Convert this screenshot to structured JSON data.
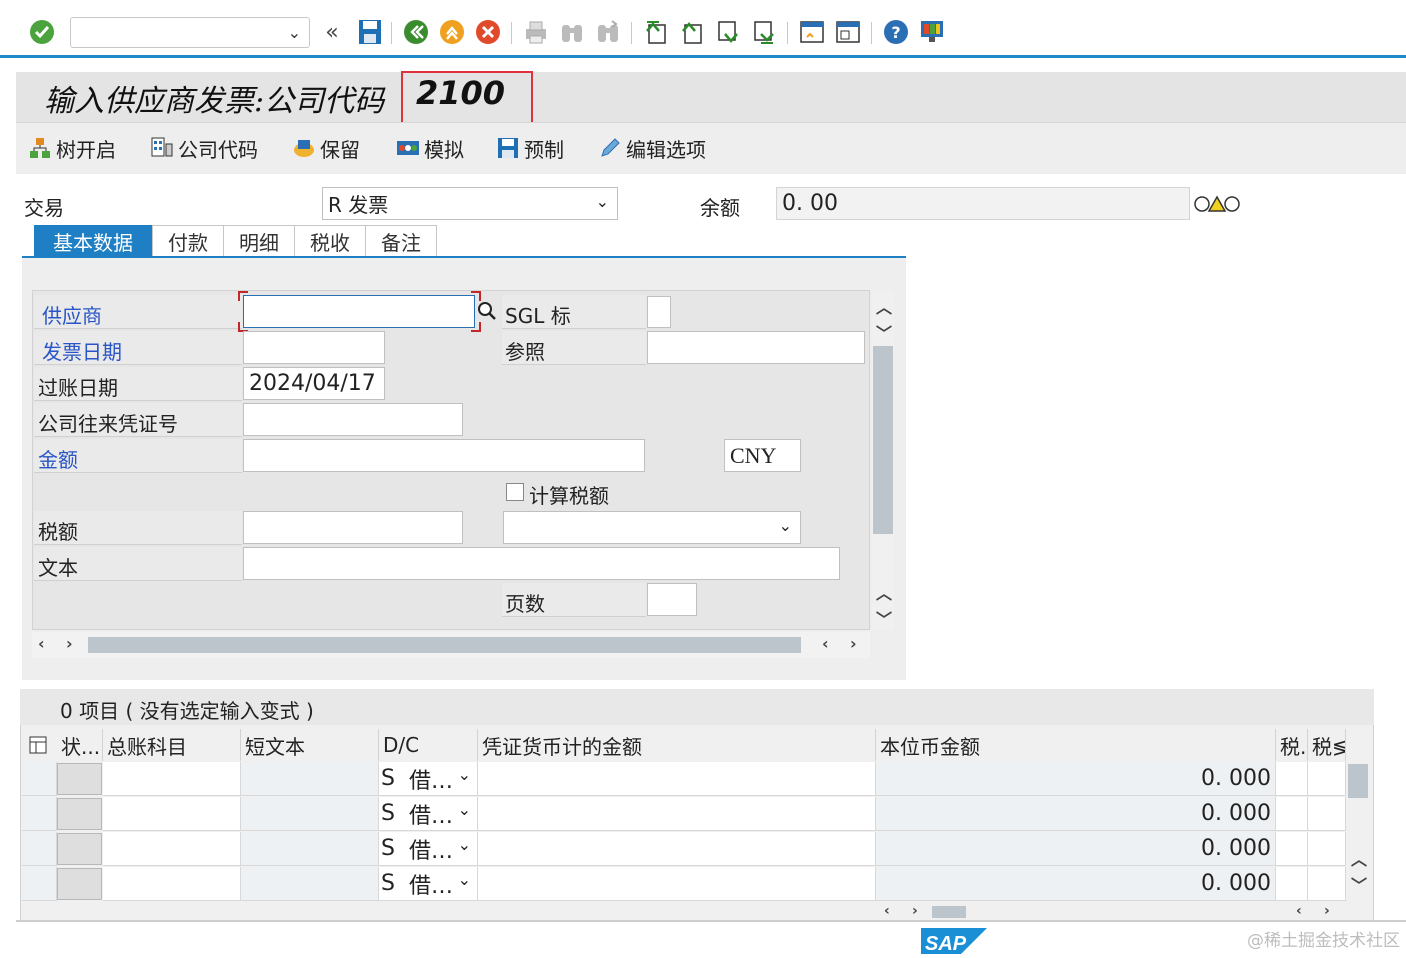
{
  "toolbar": {
    "command_field_value": "",
    "icons": [
      "enter-icon",
      "command-field",
      "back-arrows-icon",
      "save-icon",
      "back-icon",
      "exit-icon",
      "cancel-icon",
      "print-icon",
      "find-icon",
      "find-next-icon",
      "first-page-icon",
      "previous-page-icon",
      "next-page-icon",
      "last-page-icon",
      "new-session-icon",
      "shortcut-icon",
      "help-icon",
      "customize-layout-icon"
    ]
  },
  "title": {
    "text": "输入供应商发票:公司代码",
    "company_code": "2100"
  },
  "app_toolbar": {
    "tree_on": "树开启",
    "company_code": "公司代码",
    "hold": "保留",
    "simulate": "模拟",
    "park": "预制",
    "editing_options": "编辑选项"
  },
  "header": {
    "transaction_label": "交易",
    "transaction_value": "R 发票",
    "balance_label": "余额",
    "balance_value": "0. 00",
    "status_icon": "traffic-light-yellow-icon"
  },
  "tabs": [
    "基本数据",
    "付款",
    "明细",
    "税收",
    "备注"
  ],
  "form": {
    "vendor_label": "供应商",
    "vendor_value": "",
    "sgl_label": "SGL 标",
    "sgl_value": "",
    "invoice_date_label": "发票日期",
    "invoice_date_value": "",
    "reference_label": "参照",
    "reference_value": "",
    "posting_date_label": "过账日期",
    "posting_date_value": "2024/04/17",
    "cross_cc_label": "公司往来凭证号",
    "cross_cc_value": "",
    "amount_label": "金额",
    "amount_value": "",
    "currency_value": "CNY",
    "calc_tax_label": "计算税额",
    "tax_amount_label": "税额",
    "tax_amount_value": "",
    "tax_code_value": "",
    "text_label": "文本",
    "text_value": "",
    "pages_label": "页数",
    "pages_value": ""
  },
  "items": {
    "header_text": "0 项目 ( 没有选定输入变式 )",
    "columns": [
      "状...",
      "总账科目",
      "短文本",
      "D/C",
      "凭证货币计的金额",
      "本位币金额",
      "税.",
      "税≶"
    ],
    "rows": [
      {
        "gl": "",
        "short_text": "",
        "dc_code": "S",
        "dc_text": "借…",
        "doc_amount": "",
        "local_amount": "0. 000"
      },
      {
        "gl": "",
        "short_text": "",
        "dc_code": "S",
        "dc_text": "借…",
        "doc_amount": "",
        "local_amount": "0. 000"
      },
      {
        "gl": "",
        "short_text": "",
        "dc_code": "S",
        "dc_text": "借…",
        "doc_amount": "",
        "local_amount": "0. 000"
      },
      {
        "gl": "",
        "short_text": "",
        "dc_code": "S",
        "dc_text": "借…",
        "doc_amount": "",
        "local_amount": "0. 000"
      }
    ]
  },
  "footer": {
    "logo_text": "SAP",
    "watermark": "@稀土掘金技术社区"
  },
  "colors": {
    "accent_blue": "#1e7fc4",
    "highlight_red": "#e0323a",
    "label_blue": "#2a55c7"
  }
}
